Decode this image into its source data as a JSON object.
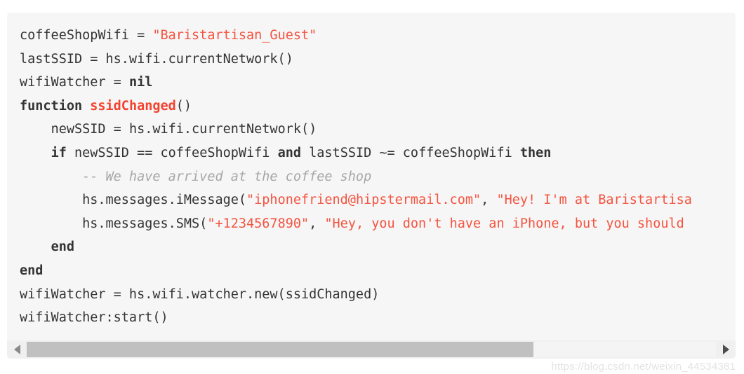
{
  "code_block": {
    "language": "lua",
    "background_color": "#f6f6f6",
    "text_color": "#333333",
    "string_color": "#f4533f",
    "function_name_color": "#f4422f",
    "comment_color": "#a6a6a6",
    "lines": [
      {
        "indent": 0,
        "tokens": [
          {
            "type": "plain",
            "text": "coffeeShopWifi = "
          },
          {
            "type": "string",
            "text": "\"Baristartisan_Guest\""
          }
        ]
      },
      {
        "indent": 0,
        "tokens": [
          {
            "type": "plain",
            "text": "lastSSID = hs.wifi.currentNetwork()"
          }
        ]
      },
      {
        "indent": 0,
        "tokens": [
          {
            "type": "plain",
            "text": "wifiWatcher = "
          },
          {
            "type": "keyword",
            "text": "nil"
          }
        ]
      },
      {
        "indent": 0,
        "tokens": [
          {
            "type": "keyword",
            "text": "function"
          },
          {
            "type": "plain",
            "text": " "
          },
          {
            "type": "function",
            "text": "ssidChanged"
          },
          {
            "type": "plain",
            "text": "()"
          }
        ]
      },
      {
        "indent": 4,
        "tokens": [
          {
            "type": "plain",
            "text": "newSSID = hs.wifi.currentNetwork()"
          }
        ]
      },
      {
        "indent": 4,
        "tokens": [
          {
            "type": "keyword",
            "text": "if"
          },
          {
            "type": "plain",
            "text": " newSSID == coffeeShopWifi "
          },
          {
            "type": "keyword",
            "text": "and"
          },
          {
            "type": "plain",
            "text": " lastSSID ~= coffeeShopWifi "
          },
          {
            "type": "keyword",
            "text": "then"
          }
        ]
      },
      {
        "indent": 8,
        "tokens": [
          {
            "type": "comment",
            "text": "-- We have arrived at the coffee shop"
          }
        ]
      },
      {
        "indent": 8,
        "tokens": [
          {
            "type": "plain",
            "text": "hs.messages.iMessage("
          },
          {
            "type": "string",
            "text": "\"iphonefriend@hipstermail.com\""
          },
          {
            "type": "plain",
            "text": ", "
          },
          {
            "type": "string",
            "text": "\"Hey! I'm at Baristartisa"
          }
        ]
      },
      {
        "indent": 8,
        "tokens": [
          {
            "type": "plain",
            "text": "hs.messages.SMS("
          },
          {
            "type": "string",
            "text": "\"+1234567890\""
          },
          {
            "type": "plain",
            "text": ", "
          },
          {
            "type": "string",
            "text": "\"Hey, you don't have an iPhone, but you should"
          }
        ]
      },
      {
        "indent": 4,
        "tokens": [
          {
            "type": "keyword",
            "text": "end"
          }
        ]
      },
      {
        "indent": 0,
        "tokens": [
          {
            "type": "keyword",
            "text": "end"
          }
        ]
      },
      {
        "indent": 0,
        "tokens": [
          {
            "type": "plain",
            "text": "wifiWatcher = hs.wifi.watcher.new(ssidChanged)"
          }
        ]
      },
      {
        "indent": 0,
        "tokens": [
          {
            "type": "plain",
            "text": "wifiWatcher:start()"
          }
        ]
      }
    ]
  },
  "scrollbar": {
    "left_arrow_icon": "triangle-left-icon",
    "right_arrow_icon": "triangle-right-icon",
    "thumb_fraction": 0.735,
    "thumb_color": "#c0c0c0",
    "track_color": "#f4f4f4"
  },
  "watermark": {
    "text": "https://blog.csdn.net/weixin_44534381"
  }
}
